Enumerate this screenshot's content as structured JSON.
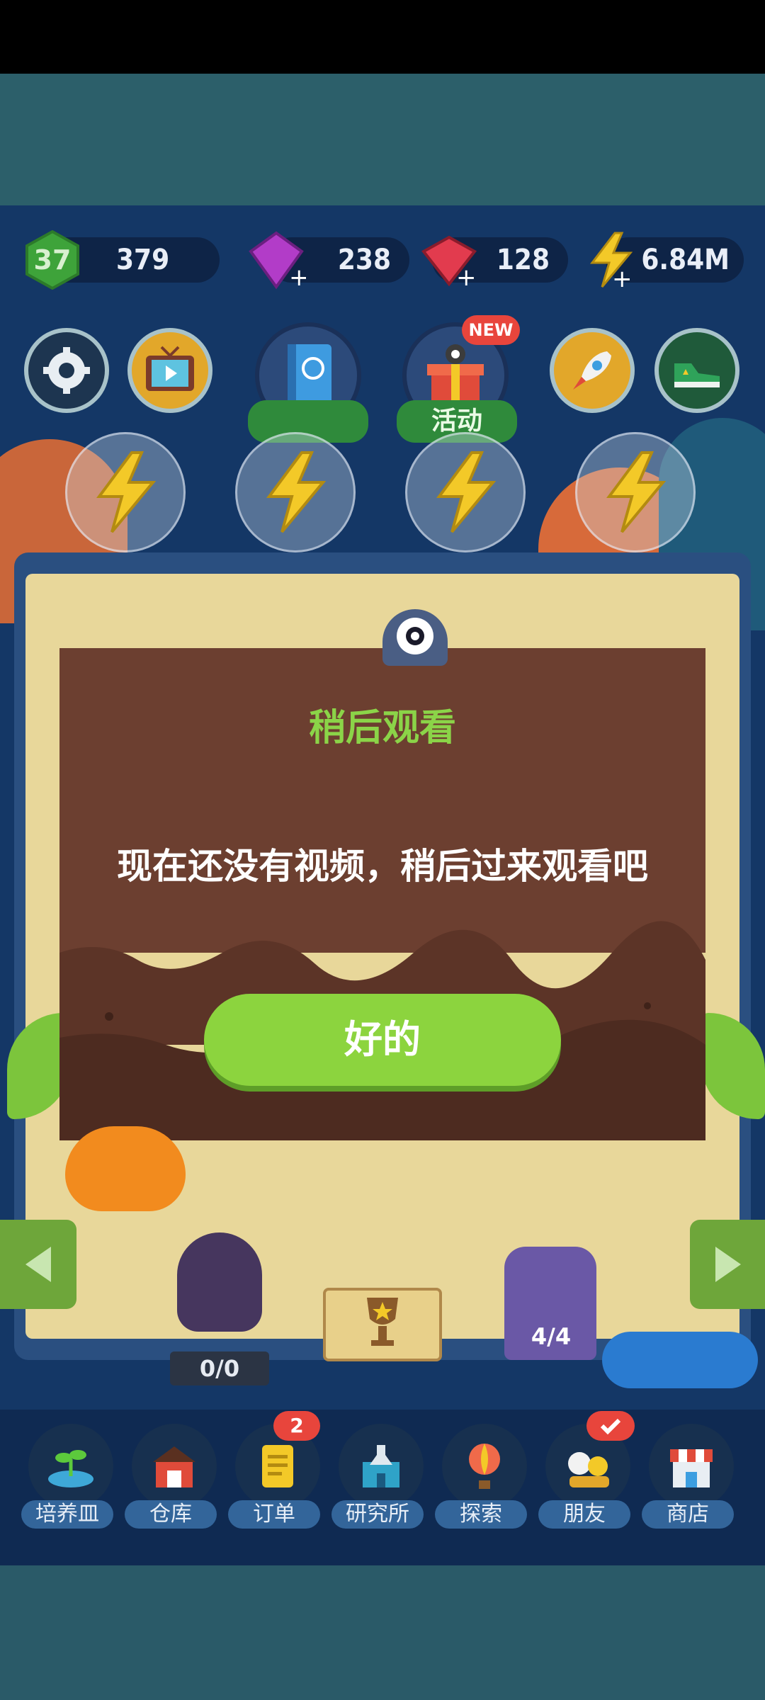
{
  "resources": {
    "level": "37",
    "level_value": "379",
    "gems_purple": "238",
    "gems_red": "128",
    "energy": "6.84M"
  },
  "top_buttons": {
    "event_badge": "NEW",
    "event_label": "活动"
  },
  "dialog": {
    "title": "稍后观看",
    "message": "现在还没有视频，稍后过来观看吧",
    "ok_label": "好的"
  },
  "scene": {
    "pedestal_count": "0/0",
    "monster_count": "4/4"
  },
  "nav": {
    "items": [
      {
        "label": "培养皿"
      },
      {
        "label": "仓库"
      },
      {
        "label": "订单",
        "badge": "2"
      },
      {
        "label": "研究所"
      },
      {
        "label": "探索"
      },
      {
        "label": "朋友"
      },
      {
        "label": "商店"
      }
    ]
  },
  "colors": {
    "dialog_bg": "#6c3f30",
    "title_green": "#8bd448",
    "button_green": "#8cd43e",
    "game_bg": "#143766",
    "badge_red": "#e8453c"
  }
}
